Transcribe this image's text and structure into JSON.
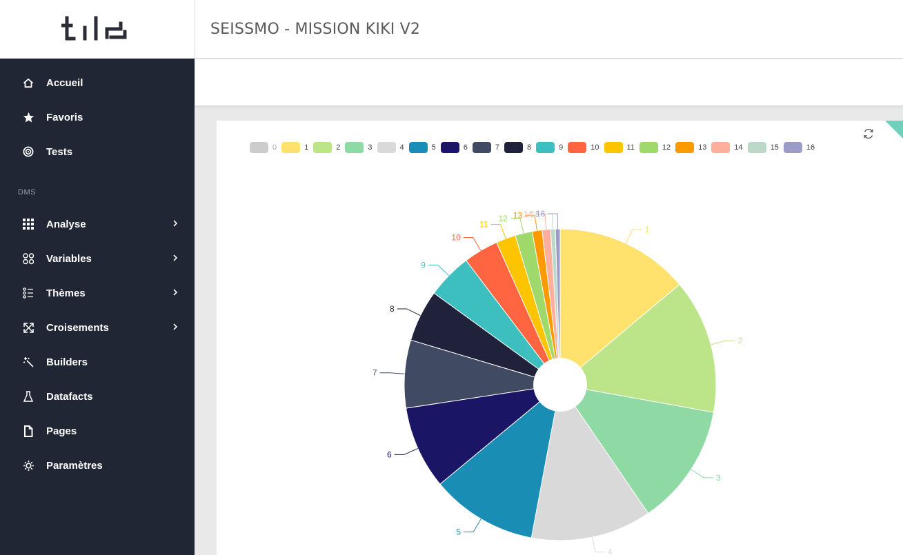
{
  "app": {
    "logo_text": "tile",
    "title": "SEISSMO - MISSION KIKI V2"
  },
  "sidebar": {
    "items": [
      {
        "label": "Accueil",
        "icon": "home-icon",
        "has_chevron": false
      },
      {
        "label": "Favoris",
        "icon": "star-icon",
        "has_chevron": false
      },
      {
        "label": "Tests",
        "icon": "target-icon",
        "has_chevron": false
      }
    ],
    "section_label": "DMS",
    "dms_items": [
      {
        "label": "Analyse",
        "icon": "grid-icon",
        "has_chevron": true
      },
      {
        "label": "Variables",
        "icon": "variables-icon",
        "has_chevron": true
      },
      {
        "label": "Thèmes",
        "icon": "list-icon",
        "has_chevron": true
      },
      {
        "label": "Croisements",
        "icon": "cross-arrows-icon",
        "has_chevron": true
      },
      {
        "label": "Builders",
        "icon": "wand-icon",
        "has_chevron": false
      },
      {
        "label": "Datafacts",
        "icon": "flask-icon",
        "has_chevron": false
      },
      {
        "label": "Pages",
        "icon": "page-icon",
        "has_chevron": false
      },
      {
        "label": "Paramètres",
        "icon": "gear-icon",
        "has_chevron": false
      }
    ]
  },
  "chart_data": {
    "type": "pie",
    "inner_radius_ratio": 0.17,
    "legend_position": "top",
    "hidden_categories": [
      "0"
    ],
    "categories": [
      "0",
      "1",
      "2",
      "3",
      "4",
      "5",
      "6",
      "7",
      "8",
      "9",
      "10",
      "11",
      "12",
      "13",
      "14",
      "15",
      "16"
    ],
    "values": [
      0,
      14.2,
      14.3,
      12.9,
      12.8,
      11.3,
      8.8,
      7.2,
      5.5,
      4.8,
      3.7,
      2.1,
      1.8,
      1.05,
      0.9,
      0.5,
      0.5
    ],
    "colors": [
      "#cccccc",
      "#ffe16e",
      "#bce58a",
      "#8ed9a4",
      "#d9d9d9",
      "#1a8db5",
      "#1b1566",
      "#414a63",
      "#20213a",
      "#3dbfbf",
      "#ff6540",
      "#ffc400",
      "#9fd96b",
      "#ff9900",
      "#ffaf9b",
      "#bcd8c9",
      "#9c9cc8"
    ]
  }
}
